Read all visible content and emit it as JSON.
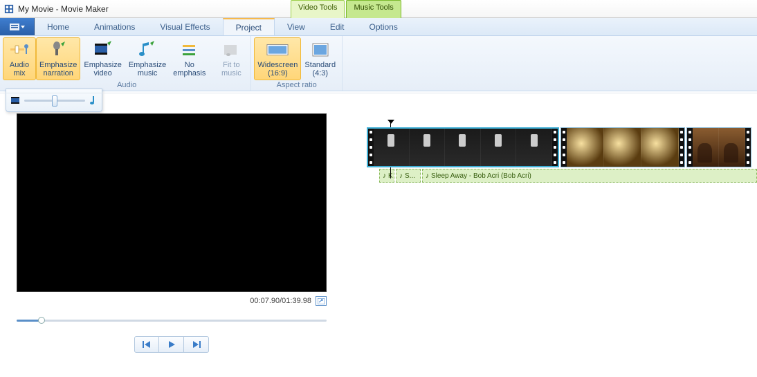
{
  "titlebar": {
    "title": "My Movie - Movie Maker",
    "video_tools": "Video Tools",
    "music_tools": "Music Tools"
  },
  "tabs": {
    "home": "Home",
    "animations": "Animations",
    "visual_effects": "Visual Effects",
    "project": "Project",
    "view": "View",
    "edit": "Edit",
    "options": "Options"
  },
  "ribbon": {
    "audio_group_label": "Audio",
    "aspect_group_label": "Aspect ratio",
    "audio_mix": {
      "l1": "Audio",
      "l2": "mix"
    },
    "emph_narration": {
      "l1": "Emphasize",
      "l2": "narration"
    },
    "emph_video": {
      "l1": "Emphasize",
      "l2": "video"
    },
    "emph_music": {
      "l1": "Emphasize",
      "l2": "music"
    },
    "no_emph": {
      "l1": "No",
      "l2": "emphasis"
    },
    "fit_music": {
      "l1": "Fit to",
      "l2": "music"
    },
    "widescreen": {
      "l1": "Widescreen",
      "l2": "(16:9)"
    },
    "standard": {
      "l1": "Standard",
      "l2": "(4:3)"
    }
  },
  "preview": {
    "time": "00:07.90/01:39.98"
  },
  "timeline": {
    "audio_seg1": "K",
    "audio_seg2": "S...",
    "audio_seg3": "Sleep Away - Bob Acri (Bob Acri)"
  }
}
